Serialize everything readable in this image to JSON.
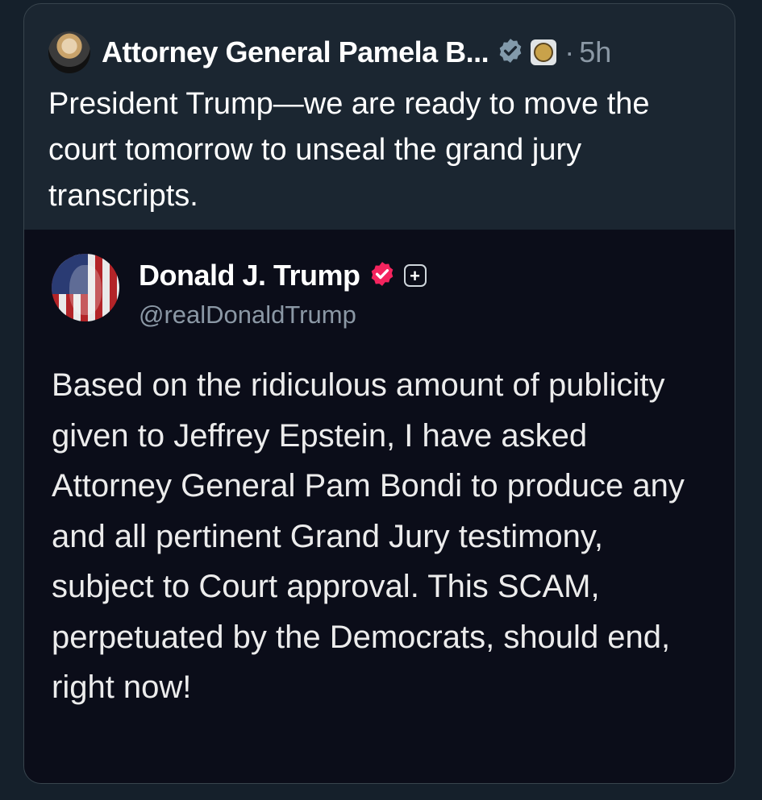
{
  "post": {
    "display_name": "Attorney General Pamela B...",
    "time_separator": "·",
    "time": "5h",
    "text": "President Trump—we are ready to move the court tomorrow to unseal the grand jury transcripts."
  },
  "quoted_post": {
    "display_name": "Donald J. Trump",
    "handle": "@realDonaldTrump",
    "plus_label": "+",
    "text": "Based on the ridiculous amount of publicity given to Jeffrey Epstein, I have asked Attorney General Pam Bondi to produce any and all pertinent Grand Jury testimony, subject to Court approval. This SCAM, perpetuated by the Democrats, should end, right now!"
  },
  "icons": {
    "ag_verified": "gray-checkmark-badge-icon",
    "ag_affiliate": "doj-seal-icon",
    "trump_verified": "pink-checkmark-badge-icon"
  },
  "colors": {
    "background": "#15202b",
    "card": "#1b2631",
    "quote_background": "#0b0d19",
    "secondary_text": "#8b98a5",
    "gray_badge": "#829aab",
    "pink_badge": "#f4245e"
  }
}
